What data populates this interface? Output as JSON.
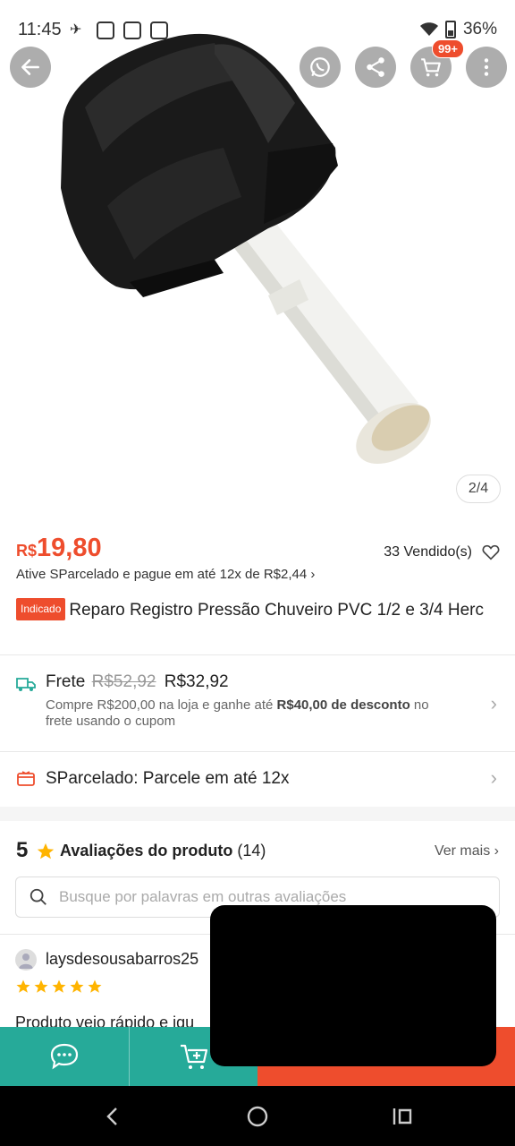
{
  "status_bar": {
    "time": "11:45",
    "battery": "36%"
  },
  "top_bar": {
    "cart_badge": "99+"
  },
  "gallery": {
    "pager": "2/4"
  },
  "product": {
    "currency": "R$",
    "price": "19,80",
    "sold": "33 Vendido(s)",
    "installment": "Ative SParcelado e pague em até 12x de R$2,44",
    "installment_chevron": "›",
    "tag": "Indicado",
    "title": "Reparo Registro Pressão Chuveiro PVC 1/2 e 3/4 Herc"
  },
  "shipping": {
    "label": "Frete",
    "old_price": "R$52,92",
    "new_price": "R$32,92",
    "desc_part1": "Compre R$200,00 na loja e ganhe até ",
    "desc_bold": "R$40,00 de desconto",
    "desc_part2": " no frete usando o cupom"
  },
  "sparcelado": {
    "label": "SParcelado: Parcele em até 12x"
  },
  "reviews": {
    "rating": "5",
    "title": "Avaliações do produto",
    "count": "(14)",
    "see_more": "Ver mais",
    "see_more_chevron": "›",
    "search_placeholder": "Busque por palavras em outras avaliações",
    "first": {
      "user": "laysdesousabarros25",
      "stars": 5,
      "text": "Produto veio rápido e igu"
    }
  },
  "colors": {
    "brand": "#ee4d2d",
    "teal": "#26aa99",
    "star": "#ffb400"
  },
  "icons": {
    "back": "back-arrow-icon",
    "whatsapp": "whatsapp-icon",
    "share": "share-icon",
    "cart": "cart-icon",
    "more": "more-vertical-icon",
    "heart": "heart-icon",
    "truck": "truck-icon",
    "card": "card-icon",
    "star": "star-icon",
    "search": "search-icon",
    "chat": "chat-icon",
    "add_cart": "add-to-cart-icon"
  }
}
